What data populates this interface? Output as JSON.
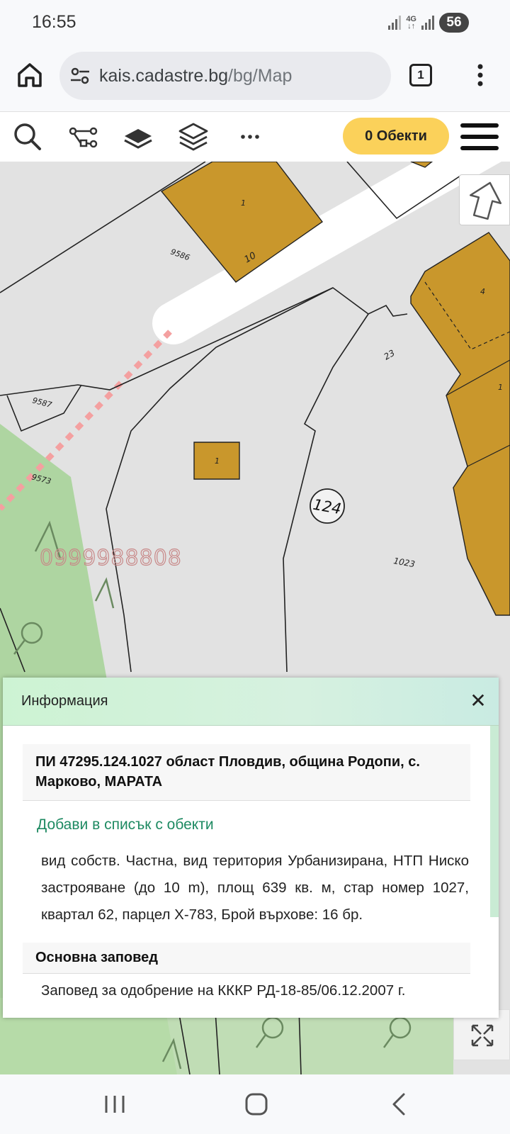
{
  "status_bar": {
    "time": "16:55",
    "network": "4G",
    "battery": "56"
  },
  "browser": {
    "url_domain": "kais.cadastre.bg",
    "url_path": "/bg/Map",
    "tab_count": "1"
  },
  "toolbar": {
    "tools": [
      "search-icon",
      "route-icon",
      "layer-icon",
      "layers-stack-icon",
      "more-icon"
    ],
    "objects_button": "0 Обекти"
  },
  "map": {
    "watermark": "0999988808",
    "quarter_label": "124",
    "parcel_labels": [
      "9586",
      "9587",
      "9573",
      "23",
      "1023",
      "10"
    ],
    "building_labels": [
      "1",
      "1",
      "4",
      "1"
    ]
  },
  "info_panel": {
    "title": "Информация",
    "parcel_heading": "ПИ 47295.124.1027 област Пловдив, община Родопи, с. Марково, МАРАТА",
    "add_link": "Добави в списък с обекти",
    "description": "вид собств. Частна, вид територия Урбанизирана, НТП Ниско застрояване (до 10 m), площ 639 кв. м, стар номер 1027, квартал 62, парцел X-783, Брой върхове: 16 бр.",
    "order_heading": "Основна заповед",
    "order_text": "Заповед за одобрение на КККР РД-18-85/06.12.2007 г."
  },
  "colors": {
    "building": "#c9972c",
    "objects_button": "#fbd15a",
    "panel_header": "#cdf3d3",
    "link": "#1e8a62",
    "green_area": "#a9d49a"
  }
}
